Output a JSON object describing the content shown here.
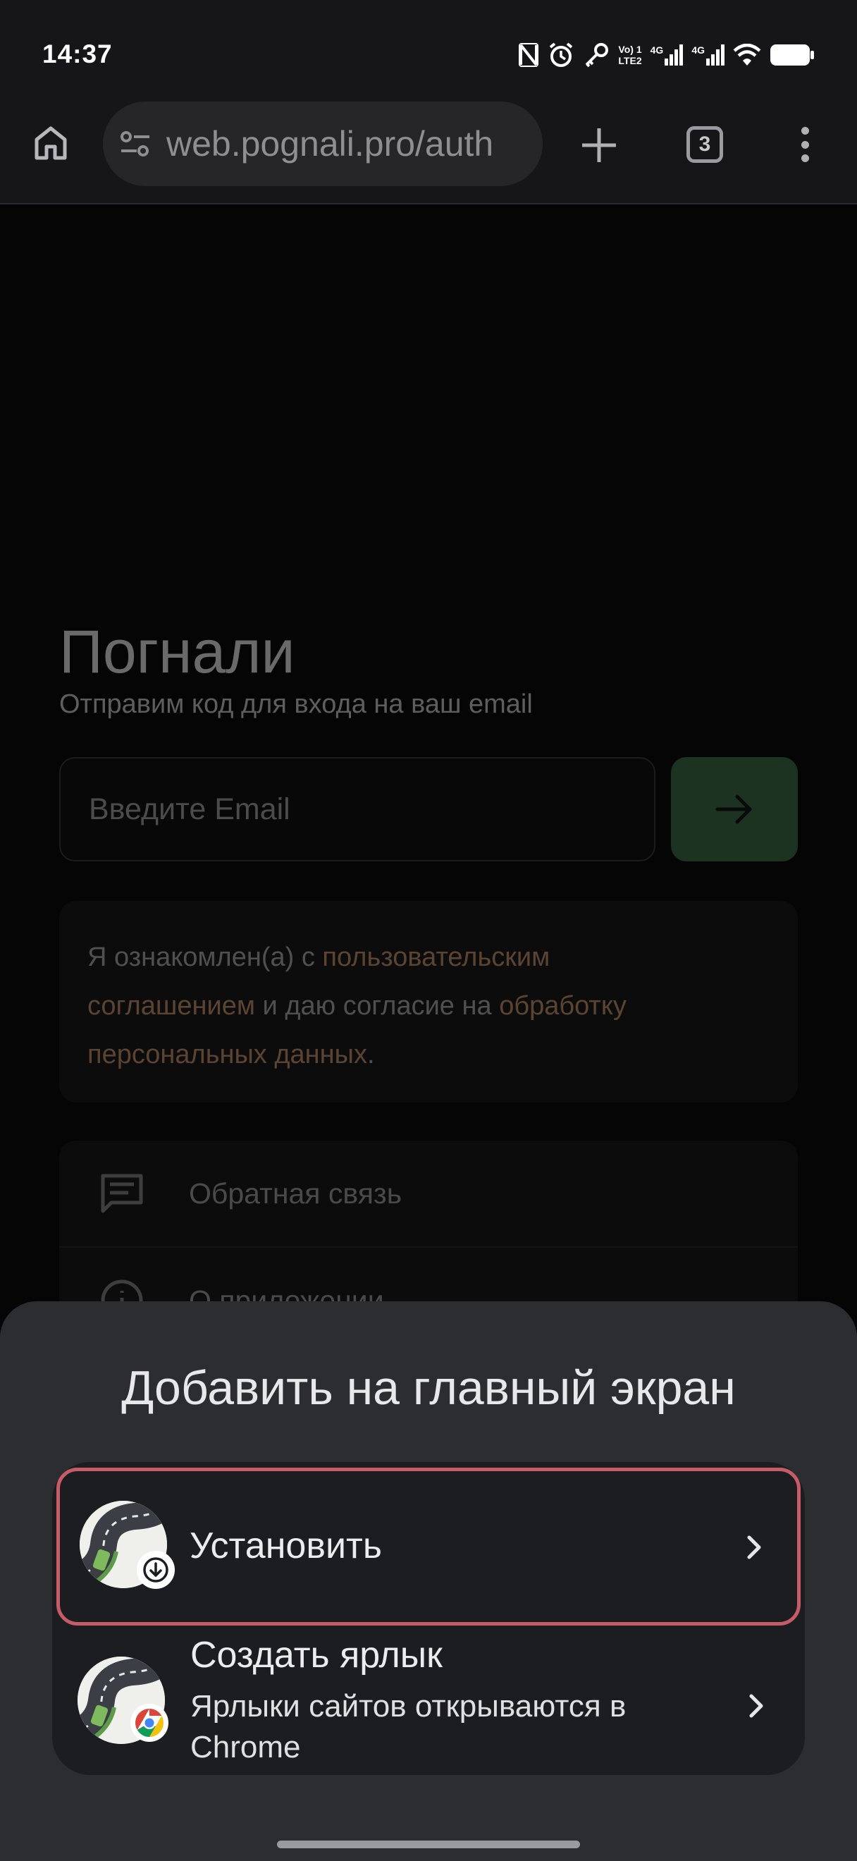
{
  "status_bar": {
    "time": "14:37",
    "network_top": "Vo) 1",
    "network_bottom": "LTE2",
    "signal_1": "4G",
    "signal_2": "4G",
    "icons": [
      "nfc-icon",
      "alarm-icon",
      "key-icon",
      "signal-icon",
      "signal-icon",
      "wifi-icon",
      "battery-icon"
    ]
  },
  "toolbar": {
    "url": "web.pognali.pro/auth",
    "tab_count": "3",
    "icons": [
      "home-icon",
      "site-settings-icon",
      "new-tab-icon",
      "tab-switcher-icon",
      "more-menu-icon"
    ]
  },
  "page": {
    "title": "Погнали",
    "subtitle": "Отправим код для входа на ваш email",
    "email_placeholder": "Введите Email",
    "consent": {
      "text_1": "Я ознакомлен(а) с ",
      "link_1a": "пользовательским",
      "link_1b": "соглашением",
      "text_2": " и даю согласие на ",
      "link_2a": "обработку",
      "link_2b": "персональных данных",
      "text_3": "."
    },
    "menu": [
      {
        "label": "Обратная связь",
        "icon": "feedback-icon"
      },
      {
        "label": "О приложении",
        "icon": "info-icon"
      }
    ]
  },
  "sheet": {
    "title": "Добавить на главный экран",
    "install_label": "Установить",
    "shortcut_label": "Создать ярлык",
    "shortcut_sub": "Ярлыки сайтов открываются в Chrome"
  },
  "colors": {
    "sheet_bg": "#2c2d31",
    "options_bg": "#1c1d21",
    "highlight": "#c65c67",
    "submit_bg": "#1c3321",
    "link": "#5b4431"
  }
}
